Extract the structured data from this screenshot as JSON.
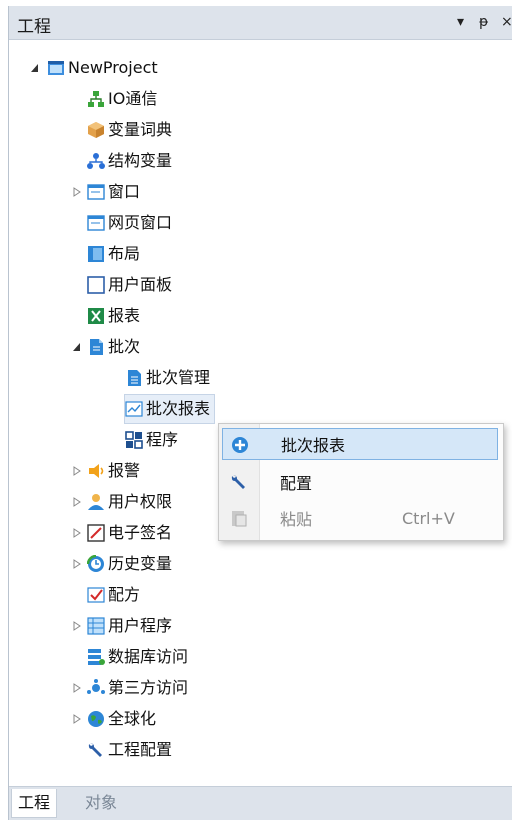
{
  "panel": {
    "title": "工程",
    "dropdown_glyph": "▾",
    "pin_glyph": "ᵽ",
    "close_glyph": "×"
  },
  "tree": {
    "root": "NewProject",
    "items": [
      {
        "label": "IO通信",
        "icon": "network-icon"
      },
      {
        "label": "变量词典",
        "icon": "box-icon"
      },
      {
        "label": "结构变量",
        "icon": "hierarchy-icon"
      },
      {
        "label": "窗口",
        "icon": "window-icon"
      },
      {
        "label": "网页窗口",
        "icon": "web-window-icon"
      },
      {
        "label": "布局",
        "icon": "layout-icon"
      },
      {
        "label": "用户面板",
        "icon": "user-panel-icon"
      },
      {
        "label": "报表",
        "icon": "excel-icon"
      },
      {
        "label": "批次",
        "icon": "document-icon"
      },
      {
        "label": "批次管理",
        "icon": "batch-manage-icon"
      },
      {
        "label": "批次报表",
        "icon": "batch-report-icon"
      },
      {
        "label": "程序",
        "icon": "program-icon"
      },
      {
        "label": "报警",
        "icon": "alarm-icon"
      },
      {
        "label": "用户权限",
        "icon": "user-icon"
      },
      {
        "label": "电子签名",
        "icon": "signature-icon"
      },
      {
        "label": "历史变量",
        "icon": "history-icon"
      },
      {
        "label": "配方",
        "icon": "recipe-icon"
      },
      {
        "label": "用户程序",
        "icon": "user-program-icon"
      },
      {
        "label": "数据库访问",
        "icon": "database-icon"
      },
      {
        "label": "第三方访问",
        "icon": "third-party-icon"
      },
      {
        "label": "全球化",
        "icon": "globe-icon"
      },
      {
        "label": "工程配置",
        "icon": "wrench-icon"
      }
    ]
  },
  "context_menu": {
    "items": [
      {
        "label": "批次报表",
        "shortcut": "",
        "icon": "add-icon"
      },
      {
        "label": "配置",
        "shortcut": "",
        "icon": "wrench-icon"
      },
      {
        "label": "粘贴",
        "shortcut": "Ctrl+V",
        "icon": "paste-icon"
      }
    ]
  },
  "bottom_tabs": [
    "工程",
    "对象"
  ],
  "colors": {
    "title_bar": "#dde3eb",
    "menu_highlight": "#d5e7f8",
    "menu_highlight_border": "#7fb2e3",
    "tree_selected": "#e6eef8"
  }
}
